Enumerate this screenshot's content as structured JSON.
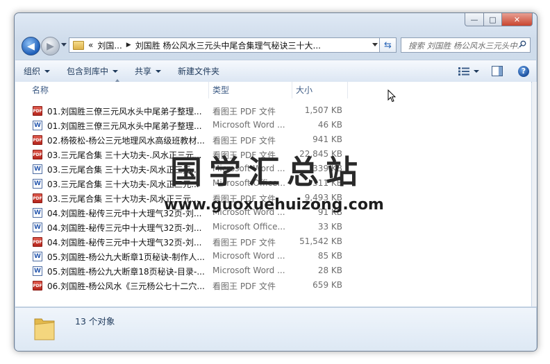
{
  "window": {
    "controls": {
      "minimize": "—",
      "maximize": "□",
      "close": "✕"
    }
  },
  "nav": {
    "back_label": "◀",
    "forward_label": "▶",
    "breadcrumb": {
      "overflow": "«",
      "items": [
        "刘国...",
        "刘国胜 杨公风水三元头中尾合集理气秘诀三十大..."
      ]
    },
    "search_placeholder": "搜索 刘国胜 杨公风水三元头中...",
    "refresh_label": "⇆"
  },
  "toolbar": {
    "organize": "组织",
    "include_in_library": "包含到库中",
    "share": "共享",
    "new_folder": "新建文件夹",
    "help": "?"
  },
  "columns": {
    "name": "名称",
    "type": "类型",
    "size": "大小"
  },
  "files": [
    {
      "icon": "pdf",
      "badge": "PDF",
      "name": "01.刘国胜三僚三元风水头中尾弟子整理...",
      "type": "看图王 PDF 文件",
      "size": "1,507 KB"
    },
    {
      "icon": "doc",
      "badge": "W",
      "name": "01.刘国胜三僚三元风水头中尾弟子整理...",
      "type": "Microsoft Word ...",
      "size": "46 KB"
    },
    {
      "icon": "pdf",
      "badge": "PDF",
      "name": "02.杨筱松-杨公三元地理风水高级班教材...",
      "type": "看图王 PDF 文件",
      "size": "941 KB"
    },
    {
      "icon": "pdf",
      "badge": "PDF",
      "name": "03.三元尾合集 三十大功夫-.风水正三元...",
      "type": "看图王 PDF 文件",
      "size": "22,845 KB"
    },
    {
      "icon": "doc",
      "badge": "W",
      "name": "03.三元尾合集 三十大功夫-风水正三元...",
      "type": "Microsoft Word ...",
      "size": "339 KB"
    },
    {
      "icon": "doc",
      "badge": "W",
      "name": "03.三元尾合集 三十大功夫-风水正三元...",
      "type": "Microsoft Office...",
      "size": "311 KB"
    },
    {
      "icon": "pdf",
      "badge": "PDF",
      "name": "03.三元尾合集 三十大功夫-风水正三元...",
      "type": "看图王 PDF 文件",
      "size": "9,493 KB"
    },
    {
      "icon": "doc",
      "badge": "W",
      "name": "04.刘国胜-秘传三元中十大理气32页-刘...",
      "type": "Microsoft Word ...",
      "size": "91 KB"
    },
    {
      "icon": "doc",
      "badge": "W",
      "name": "04.刘国胜-秘传三元中十大理气32页-刘...",
      "type": "Microsoft Office...",
      "size": "33 KB"
    },
    {
      "icon": "pdf",
      "badge": "PDF",
      "name": "04.刘国胜-秘传三元中十大理气32页-刘...",
      "type": "看图王 PDF 文件",
      "size": "51,542 KB"
    },
    {
      "icon": "doc",
      "badge": "W",
      "name": "05.刘国胜-杨公九大断章1页秘诀-制作人...",
      "type": "Microsoft Word ...",
      "size": "85 KB"
    },
    {
      "icon": "doc",
      "badge": "W",
      "name": "05.刘国胜-杨公九大断章18页秘诀-目录-...",
      "type": "Microsoft Word ...",
      "size": "28 KB"
    },
    {
      "icon": "pdf",
      "badge": "PDF",
      "name": "06.刘国胜-杨公风水《三元杨公七十二穴...",
      "type": "看图王 PDF 文件",
      "size": "659 KB"
    }
  ],
  "watermark": {
    "title": "国学汇总站",
    "url": "www.guoxuehuizong.com"
  },
  "status": {
    "count_text": "13 个对象"
  }
}
